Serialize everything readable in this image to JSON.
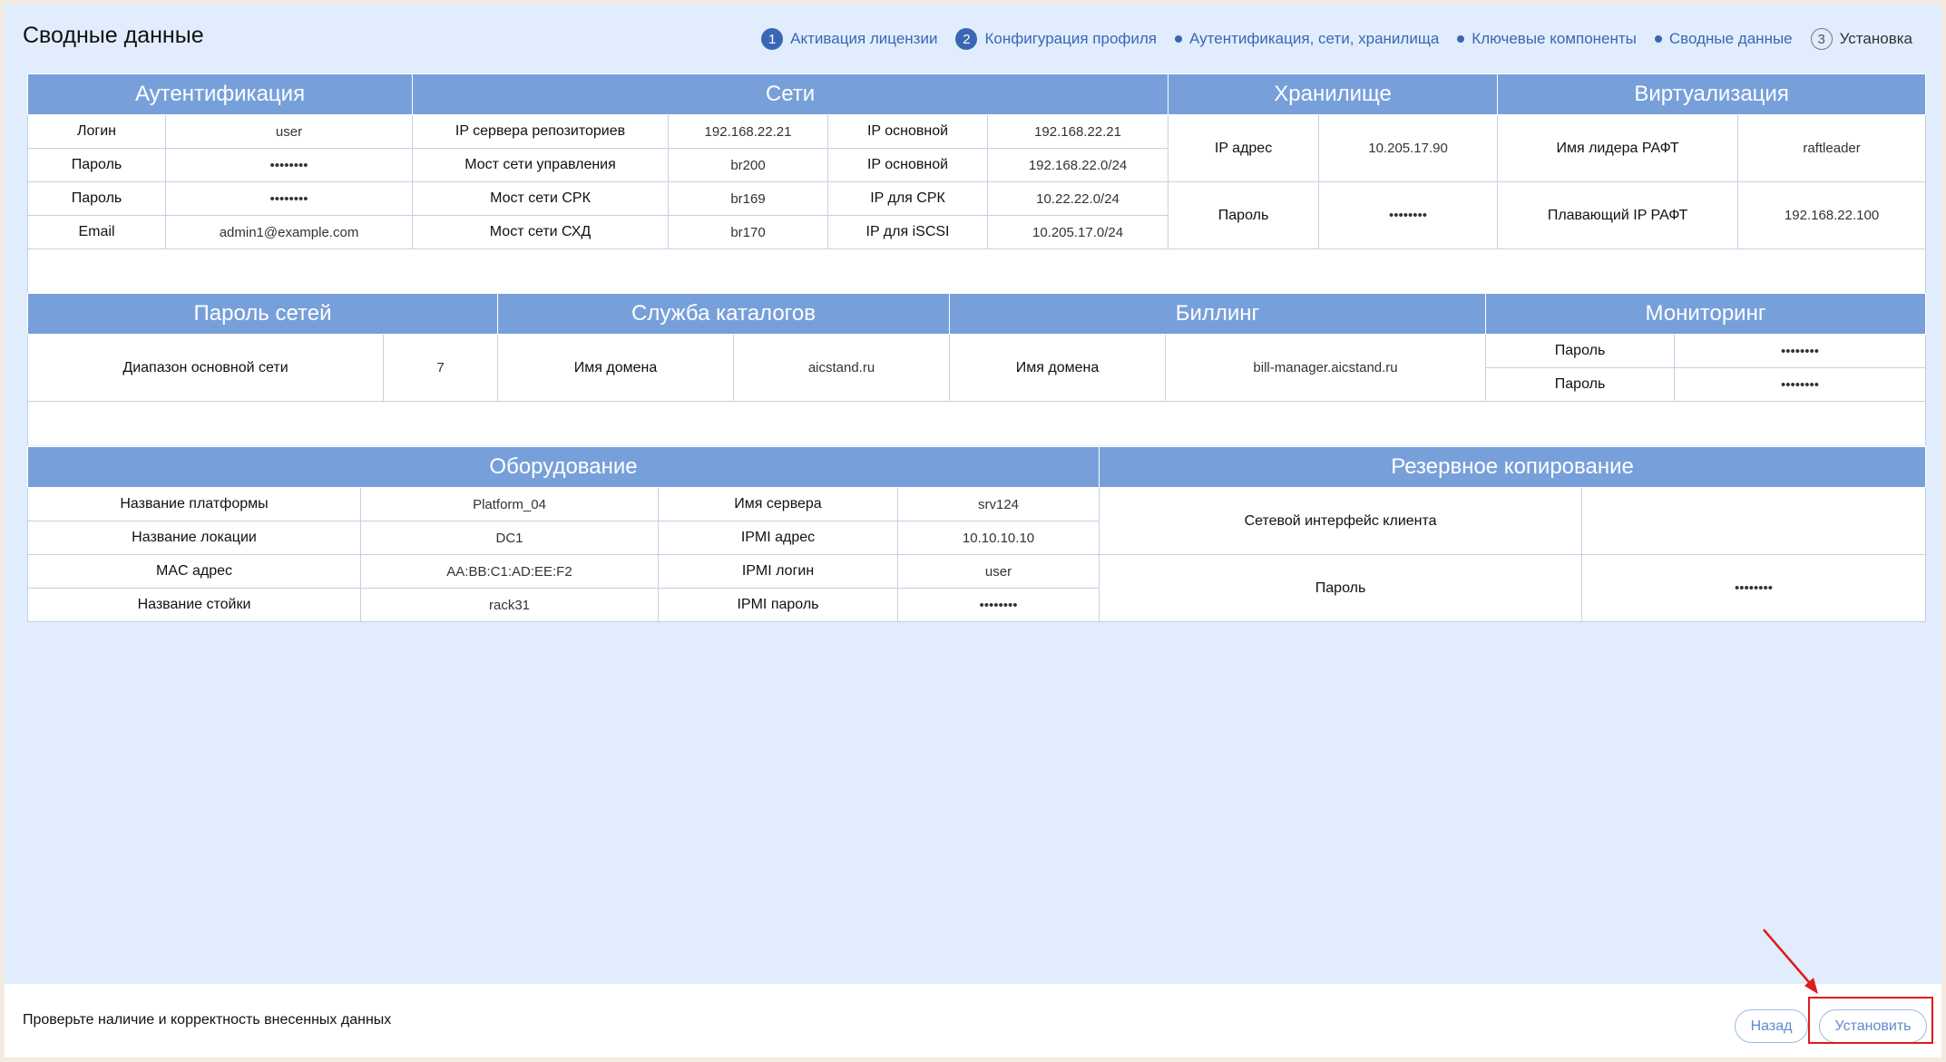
{
  "page": {
    "title": "Сводные данные",
    "footer_message": "Проверьте наличие и корректность внесенных данных",
    "back_label": "Назад",
    "install_label": "Установить"
  },
  "steps": [
    {
      "marker": "1",
      "label": "Активация лицензии"
    },
    {
      "marker": "2",
      "label": "Конфигурация профиля"
    },
    {
      "marker": "",
      "label": "Аутентификация, сети, хранилища"
    },
    {
      "marker": "",
      "label": "Ключевые компоненты"
    },
    {
      "marker": "",
      "label": "Сводные данные"
    },
    {
      "marker": "3",
      "label": "Установка"
    }
  ],
  "t1": {
    "headers": [
      "Аутентификация",
      "Сети",
      "Хранилище",
      "Виртуализация"
    ],
    "auth": [
      {
        "label": "Логин",
        "value": "user"
      },
      {
        "label": "Пароль",
        "value": "••••••••"
      },
      {
        "label": "Пароль",
        "value": "••••••••"
      },
      {
        "label": "Email",
        "value": "admin1@example.com"
      }
    ],
    "net": [
      {
        "label": "IP сервера репозиториев",
        "value": "192.168.22.21",
        "label2": "IP основной",
        "value2": "192.168.22.21"
      },
      {
        "label": "Мост сети управления",
        "value": "br200",
        "label2": "IP основной",
        "value2": "192.168.22.0/24"
      },
      {
        "label": "Мост сети СРК",
        "value": "br169",
        "label2": "IP для СРК",
        "value2": "10.22.22.0/24"
      },
      {
        "label": "Мост сети СХД",
        "value": "br170",
        "label2": "IP для iSCSI",
        "value2": "10.205.17.0/24"
      }
    ],
    "storage": [
      {
        "label": "IP адрес",
        "value": "10.205.17.90"
      },
      {
        "label": "Пароль",
        "value": "••••••••"
      }
    ],
    "virt": [
      {
        "label": "Имя лидера РАФТ",
        "value": "raftleader"
      },
      {
        "label": "Плавающий IP РАФТ",
        "value": "192.168.22.100"
      }
    ]
  },
  "t2": {
    "headers": [
      "Пароль сетей",
      "Служба каталогов",
      "Биллинг",
      "Мониторинг"
    ],
    "netpass": {
      "label": "Диапазон основной сети",
      "value": "7"
    },
    "catalog": {
      "label": "Имя домена",
      "value": "aicstand.ru"
    },
    "billing": {
      "label": "Имя домена",
      "value": "bill-manager.aicstand.ru"
    },
    "monitoring": [
      {
        "label": "Пароль",
        "value": "••••••••"
      },
      {
        "label": "Пароль",
        "value": "••••••••"
      }
    ]
  },
  "t3": {
    "headers": [
      "Оборудование",
      "Резервное копирование"
    ],
    "hw": [
      {
        "label": "Название платформы",
        "value": "Platform_04",
        "label2": "Имя сервера",
        "value2": "srv124"
      },
      {
        "label": "Название локации",
        "value": "DC1",
        "label2": "IPMI адрес",
        "value2": "10.10.10.10"
      },
      {
        "label": "MAC адрес",
        "value": "AA:BB:C1:AD:EE:F2",
        "label2": "IPMI логин",
        "value2": "user"
      },
      {
        "label": "Название стойки",
        "value": "rack31",
        "label2": "IPMI пароль",
        "value2": "••••••••"
      }
    ],
    "backup": [
      {
        "label": "Сетевой интерфейс клиента",
        "value": ""
      },
      {
        "label": "Пароль",
        "value": "••••••••"
      }
    ]
  },
  "colors": {
    "page_bg": "#e1edfd",
    "header_bg": "#77a0da",
    "accent": "#3a67b4",
    "highlight": "#e01b1b"
  }
}
